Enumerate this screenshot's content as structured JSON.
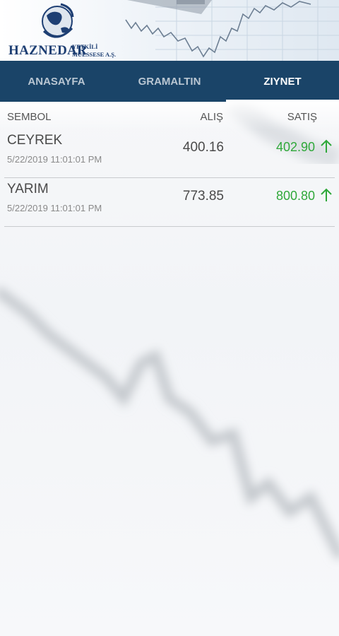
{
  "header": {
    "brand": "HAZNEDAR",
    "brand_sub_line1": "YETKİLİ",
    "brand_sub_line2": "MÜESSESE A.Ş."
  },
  "tabs": [
    {
      "label": "ANASAYFA",
      "active": false
    },
    {
      "label": "GRAMALTIN",
      "active": false
    },
    {
      "label": "ZIYNET",
      "active": true
    }
  ],
  "table": {
    "columns": {
      "symbol": "SEMBOL",
      "buy": "ALIŞ",
      "sell": "SATIŞ"
    },
    "rows": [
      {
        "name": "CEYREK",
        "date": "5/22/2019 11:01:01 PM",
        "buy": "400.16",
        "sell": "402.90",
        "trend": "up-arrow-icon"
      },
      {
        "name": "YARIM",
        "date": "5/22/2019 11:01:01 PM",
        "buy": "773.85",
        "sell": "800.80",
        "trend": "up-arrow-icon"
      }
    ]
  },
  "colors": {
    "tab_bar": "#1a4468",
    "up": "#2fa83a",
    "brand": "#1e3f73"
  }
}
